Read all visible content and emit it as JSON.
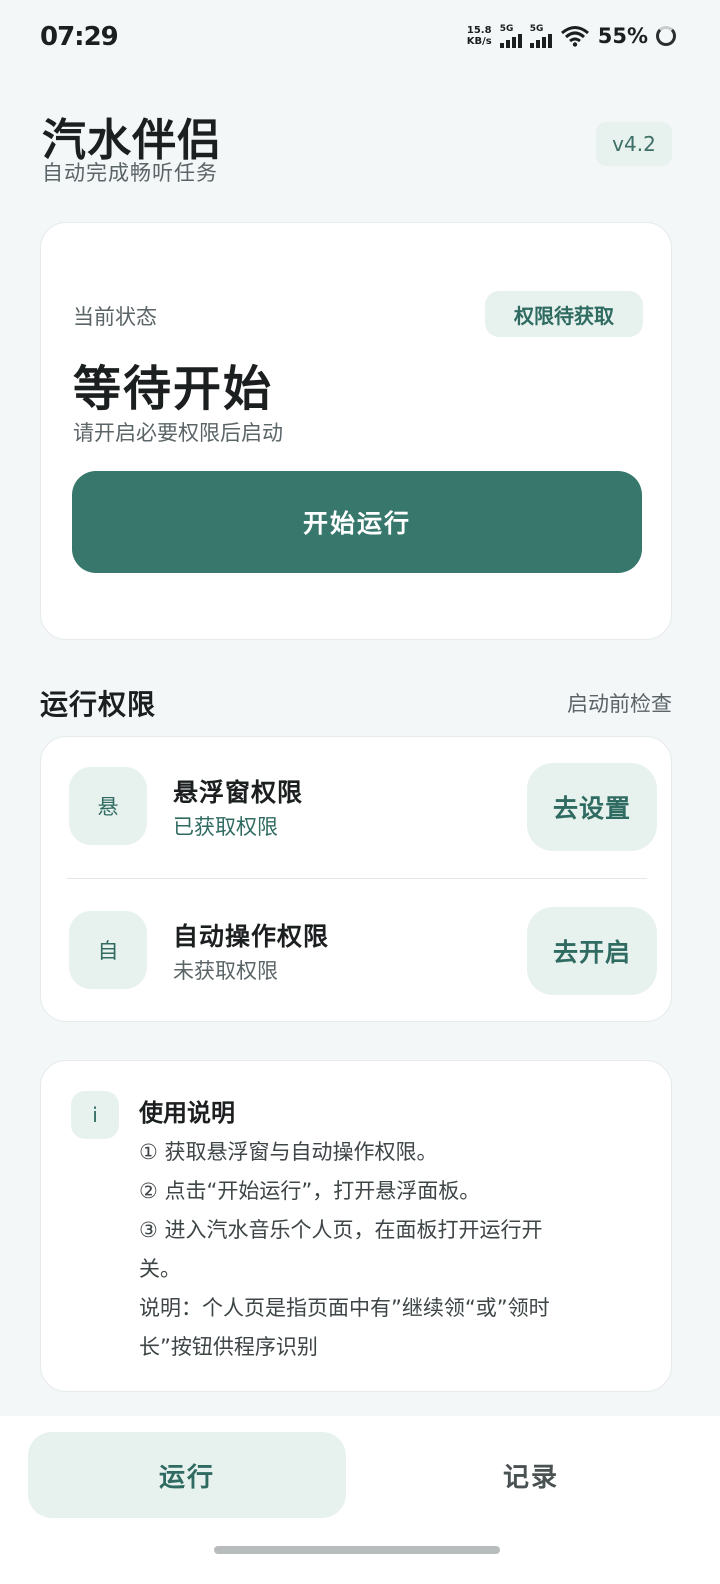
{
  "status_bar": {
    "time": "07:29",
    "net_speed_value": "15.8",
    "net_speed_unit": "KB/s",
    "signal1_label": "5G",
    "signal2_label": "5G",
    "battery": "55%",
    "icons": [
      "signal-icon",
      "wifi-icon",
      "battery-icon"
    ]
  },
  "header": {
    "title": "汽水伴侣",
    "subtitle": "自动完成畅听任务",
    "version": "v4.2"
  },
  "status_card": {
    "label": "当前状态",
    "badge": "权限待获取",
    "status": "等待开始",
    "hint": "请开启必要权限后启动",
    "start_button": "开始运行"
  },
  "permissions": {
    "title": "运行权限",
    "side_label": "启动前检查",
    "items": [
      {
        "icon_text": "悬",
        "name": "悬浮窗权限",
        "state": "已获取权限",
        "action": "去设置"
      },
      {
        "icon_text": "自",
        "name": "自动操作权限",
        "state": "未获取权限",
        "action": "去开启"
      }
    ]
  },
  "help": {
    "icon_text": "i",
    "title": "使用说明",
    "lines": [
      "① 获取悬浮窗与自动操作权限。",
      "② 点击“开始运行”，打开悬浮面板。",
      "③ 进入汽水音乐个人页，在面板打开运行开",
      "关。",
      "说明：个人页是指页面中有”继续领“或”领时",
      "长”按钮供程序识别"
    ]
  },
  "bottom_nav": {
    "run": "运行",
    "log": "记录"
  },
  "colors": {
    "accent": "#37776c",
    "accent_light": "#e7f1ee",
    "background": "#f4f7f8"
  }
}
